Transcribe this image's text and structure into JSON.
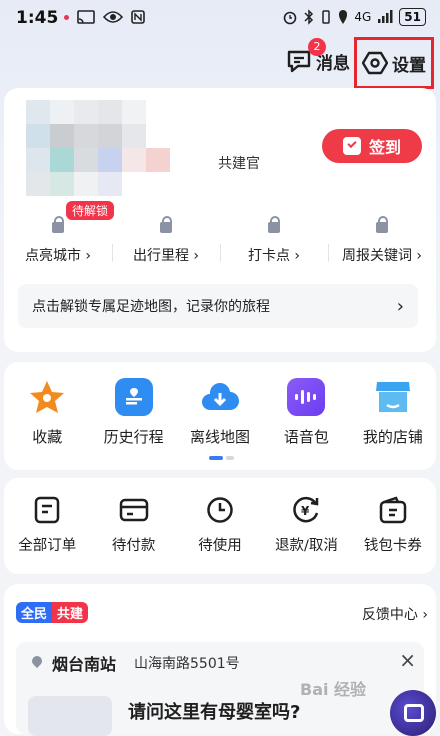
{
  "status": {
    "time": "1:45",
    "network": "4G",
    "battery": "51"
  },
  "header": {
    "messages_label": "消息",
    "messages_badge": "2",
    "settings_label": "设置"
  },
  "profile": {
    "name_suffix": "共建官",
    "checkin_label": "签到",
    "locked_badge": "待解锁",
    "stats": [
      "点亮城市 ›",
      "出行里程 ›",
      "打卡点 ›",
      "周报关键词 ›"
    ],
    "unlock_text": "点击解锁专属足迹地图，记录你的旅程",
    "unlock_arrow": "›"
  },
  "tools": [
    {
      "label": "收藏",
      "icon": "star-icon",
      "color": "#f28a1e"
    },
    {
      "label": "历史行程",
      "icon": "map-doc-icon",
      "color": "#2f8cf0"
    },
    {
      "label": "离线地图",
      "icon": "cloud-download-icon",
      "color": "#2f8cf0"
    },
    {
      "label": "语音包",
      "icon": "voice-wave-icon",
      "color": "#7a4cf0"
    },
    {
      "label": "我的店铺",
      "icon": "store-icon",
      "color": "#3ba4f0"
    }
  ],
  "orders": [
    {
      "label": "全部订单",
      "icon": "order-list-icon"
    },
    {
      "label": "待付款",
      "icon": "card-icon"
    },
    {
      "label": "待使用",
      "icon": "clock-icon"
    },
    {
      "label": "退款/取消",
      "icon": "refund-icon"
    },
    {
      "label": "钱包卡券",
      "icon": "wallet-icon"
    }
  ],
  "community": {
    "tag_left": "全民",
    "tag_right": "共建",
    "feedback_label": "反馈中心 ›",
    "place_name": "烟台南站",
    "place_addr": "山海南路5501号",
    "close": "×",
    "question": "请问这里有母婴室吗?"
  },
  "watermark": "Bai 经验"
}
